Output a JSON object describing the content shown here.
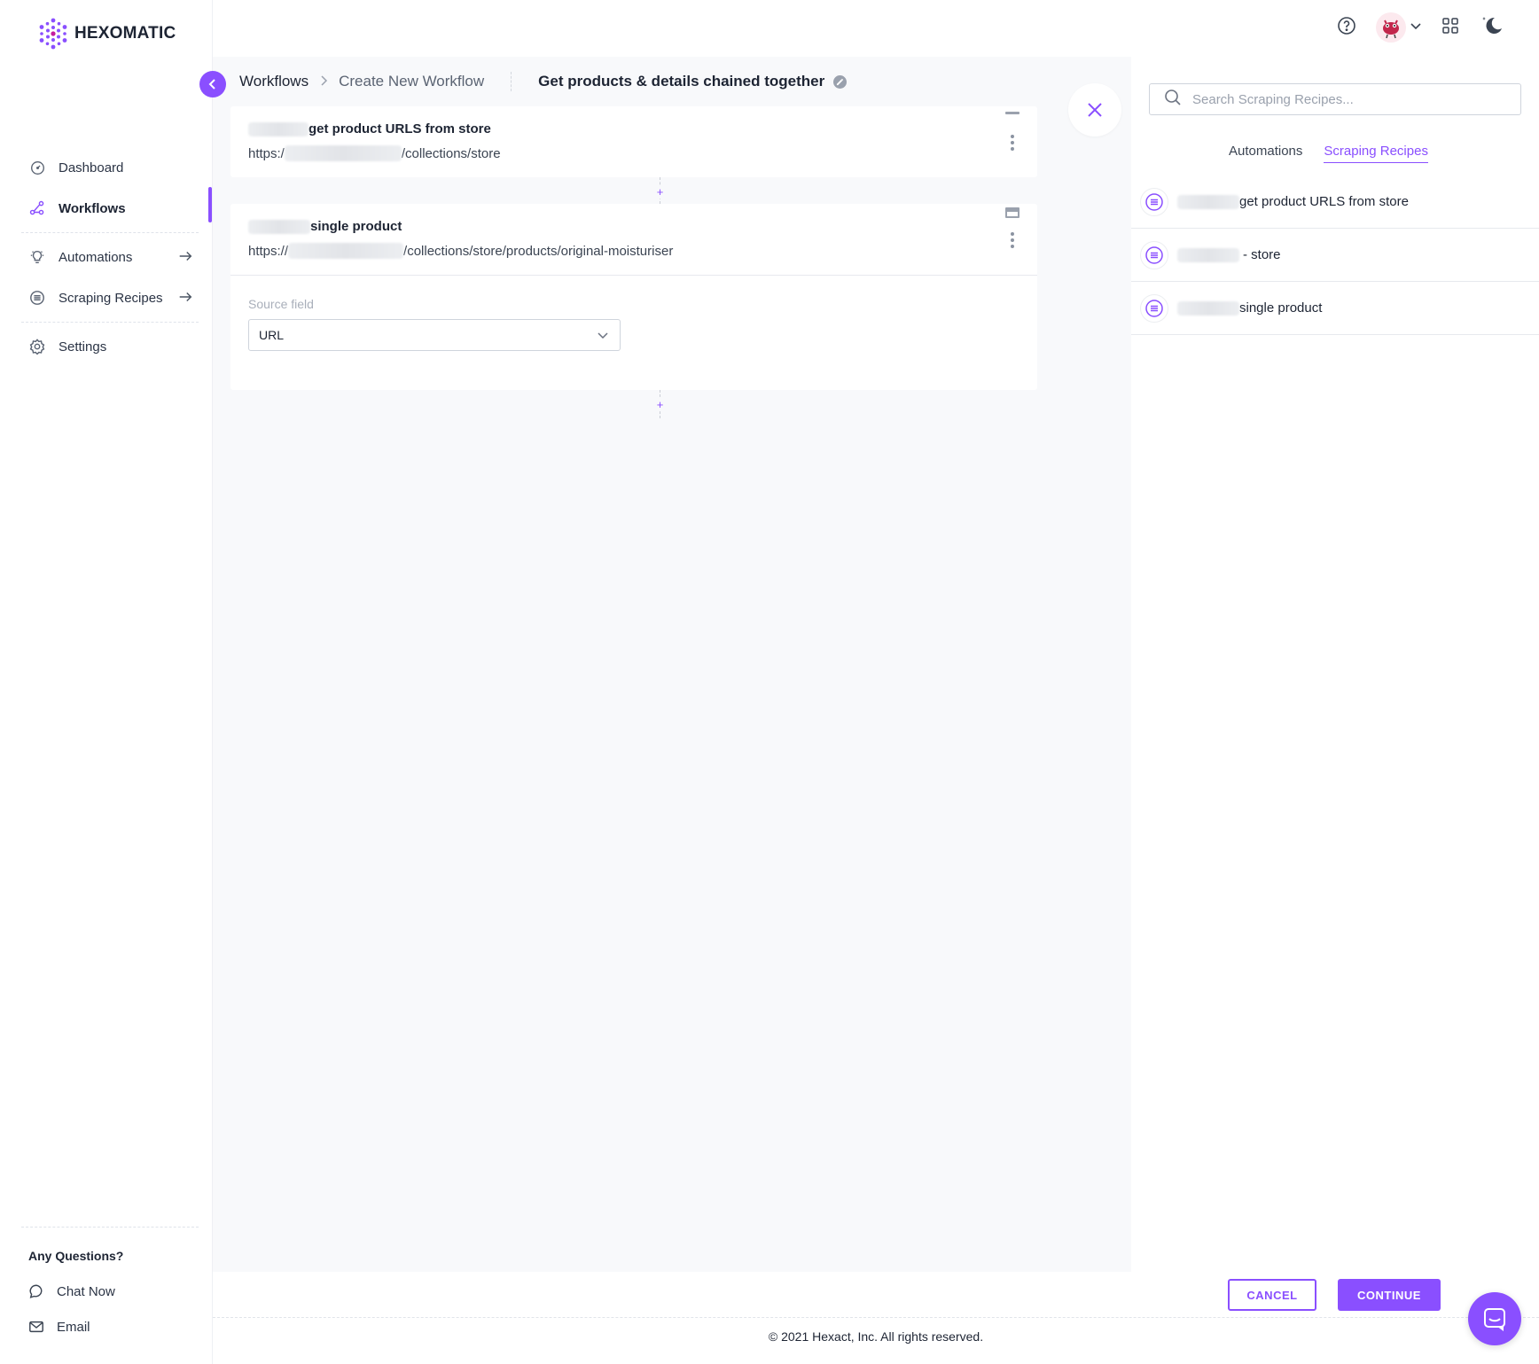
{
  "brand": {
    "name": "HEXOMATIC",
    "accent": "#8a4fff"
  },
  "sidebar": {
    "items": [
      {
        "label": "Dashboard",
        "icon": "gauge-icon"
      },
      {
        "label": "Workflows",
        "icon": "workflow-icon",
        "active": true
      },
      {
        "label": "Automations",
        "icon": "lightbulb-icon",
        "arrow": "arrow-right-icon"
      },
      {
        "label": "Scraping Recipes",
        "icon": "recipe-icon",
        "arrow": "arrow-right-icon"
      },
      {
        "label": "Settings",
        "icon": "gear-icon"
      }
    ],
    "questions_title": "Any Questions?",
    "chat_label": "Chat Now",
    "email_label": "Email"
  },
  "breadcrumb": {
    "root": "Workflows",
    "current": "Create New Workflow"
  },
  "workflow": {
    "title": "Get products & details chained together"
  },
  "cards": [
    {
      "title": "get product URLS from store",
      "url_prefix": "https:/",
      "url_suffix": "/collections/store"
    },
    {
      "title": "single product",
      "url_prefix": "https://",
      "url_suffix": "/collections/store/products/original-moisturiser",
      "source_field_label": "Source field",
      "source_field_value": "URL"
    }
  ],
  "right_panel": {
    "search_placeholder": "Search Scraping Recipes...",
    "tabs": [
      {
        "label": "Automations",
        "active": false
      },
      {
        "label": "Scraping Recipes",
        "active": true
      }
    ],
    "recipes": [
      {
        "label": "get product URLS from store"
      },
      {
        "label": "- store"
      },
      {
        "label": "single product"
      }
    ]
  },
  "actions": {
    "cancel_label": "CANCEL",
    "continue_label": "CONTINUE"
  },
  "footer": {
    "copyright": "© 2021 Hexact, Inc. All rights reserved."
  }
}
